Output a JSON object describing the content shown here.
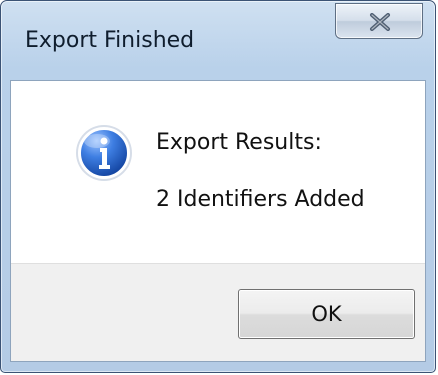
{
  "window": {
    "title": "Export Finished"
  },
  "message": {
    "line1": "Export Results:",
    "line2": "2 Identifiers Added"
  },
  "buttons": {
    "ok": "OK"
  },
  "icons": {
    "close": "close-icon",
    "info": "info-icon"
  },
  "colors": {
    "accent": "#2f63c8",
    "title_bar": "#b9d1ea",
    "footer": "#f0f0f0"
  }
}
